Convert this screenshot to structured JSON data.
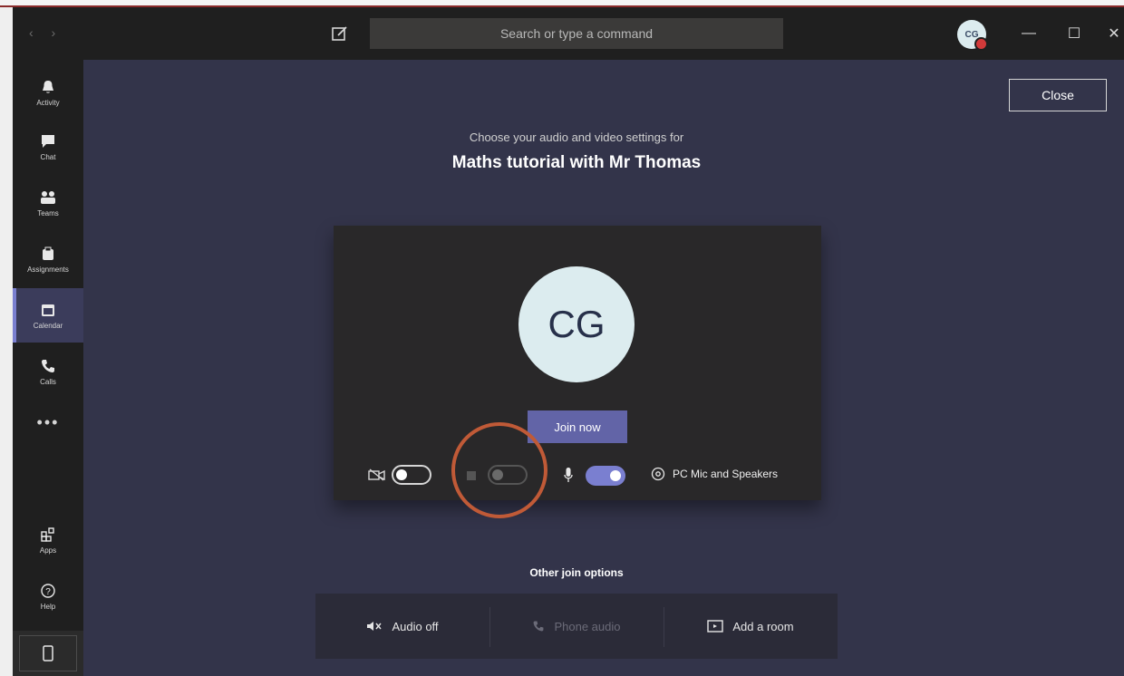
{
  "search": {
    "placeholder": "Search or type a command"
  },
  "titlebar": {
    "avatar_initials": "CG"
  },
  "rail": {
    "items": [
      {
        "label": "Activity",
        "icon": "bell-icon"
      },
      {
        "label": "Chat",
        "icon": "chat-icon"
      },
      {
        "label": "Teams",
        "icon": "teams-icon"
      },
      {
        "label": "Assignments",
        "icon": "assignments-icon"
      },
      {
        "label": "Calendar",
        "icon": "calendar-icon",
        "active": true
      },
      {
        "label": "Calls",
        "icon": "phone-icon"
      },
      {
        "label": "•••",
        "icon": "more-icon"
      },
      {
        "label": "Apps",
        "icon": "apps-icon"
      },
      {
        "label": "Help",
        "icon": "help-icon"
      }
    ]
  },
  "header": {
    "close_label": "Close",
    "subtitle": "Choose your audio and video settings for",
    "meeting_title": "Maths tutorial with Mr Thomas"
  },
  "preview": {
    "avatar_initials": "CG",
    "join_label": "Join now",
    "video_toggle": "off",
    "blur_toggle": "disabled",
    "mic_toggle": "on",
    "device_label": "PC Mic and Speakers"
  },
  "other": {
    "title": "Other join options",
    "options": [
      {
        "label": "Audio off",
        "enabled": true
      },
      {
        "label": "Phone audio",
        "enabled": false
      },
      {
        "label": "Add a room",
        "enabled": true
      }
    ]
  },
  "colors": {
    "accent": "#6264a7",
    "highlight_ring": "#c05a37"
  }
}
